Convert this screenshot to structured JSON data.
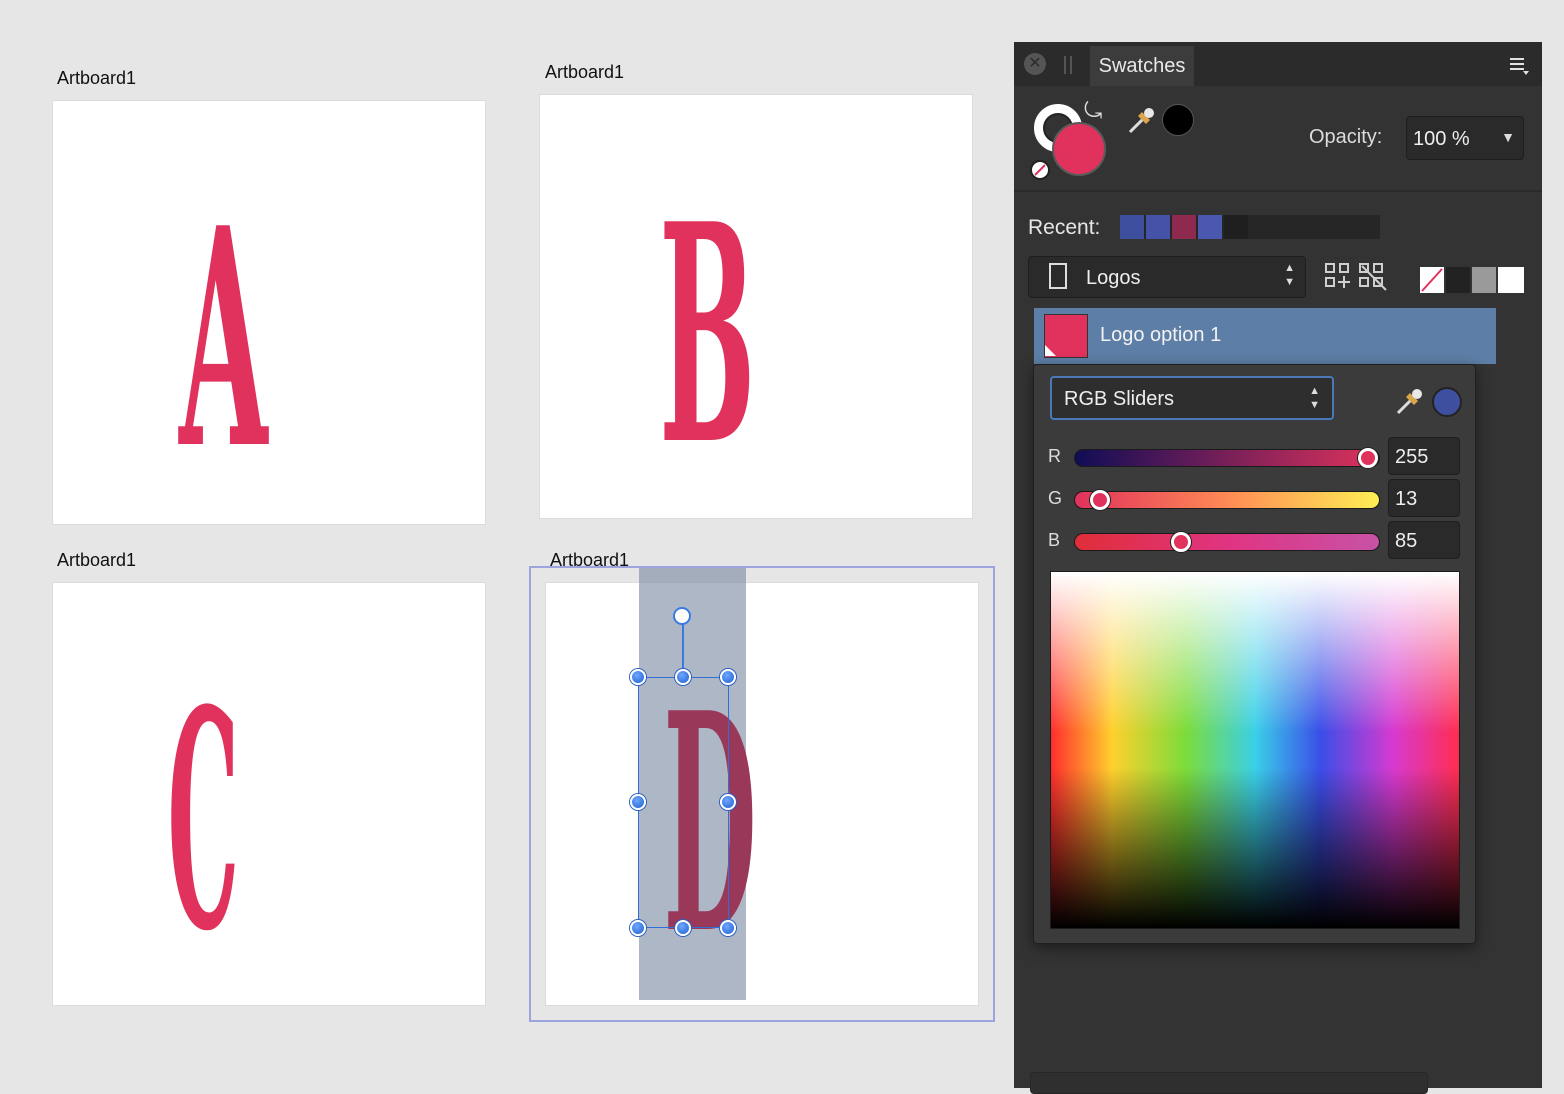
{
  "artboards": [
    {
      "label": "Artboard1",
      "letter": "A"
    },
    {
      "label": "Artboard1",
      "letter": "B"
    },
    {
      "label": "Artboard1",
      "letter": "C"
    },
    {
      "label": "Artboard1",
      "letter": "D"
    }
  ],
  "swatches_panel": {
    "tab_title": "Swatches",
    "opacity_label": "Opacity:",
    "opacity_value": "100 %",
    "recent_label": "Recent:",
    "recent_colors": [
      "#3f4fa0",
      "#4452a8",
      "#8e2a4e",
      "#4b58b0",
      "#1f1f1f"
    ],
    "palette_name": "Logos",
    "quick_swatches": [
      "none",
      "#222222",
      "#9a9a9a",
      "#ffffff"
    ],
    "selected_swatch": {
      "name": "Logo option 1",
      "color": "#e0325c"
    },
    "fill_color": "#e0325c"
  },
  "color_popup": {
    "mode": "RGB Sliders",
    "picked_color": "#3f4fa0",
    "channels": [
      {
        "name": "R",
        "value": "255",
        "fraction": 1.0
      },
      {
        "name": "G",
        "value": "13",
        "fraction": 0.051
      },
      {
        "name": "B",
        "value": "85",
        "fraction": 0.333
      }
    ]
  }
}
